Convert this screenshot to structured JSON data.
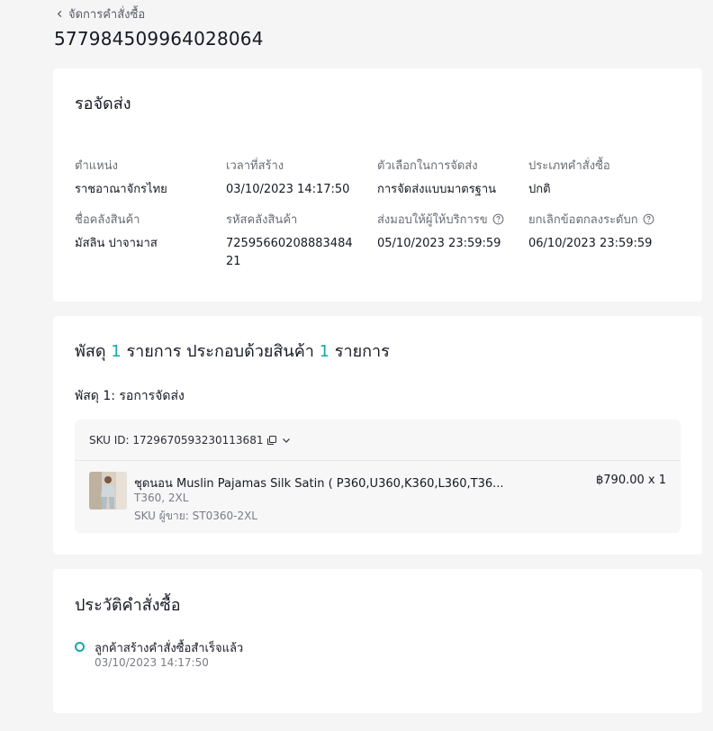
{
  "header": {
    "back_label": "จัดการคำสั่งซื้อ",
    "order_id": "577984509964028064"
  },
  "status_card": {
    "title": "รอจัดส่ง",
    "fields": [
      {
        "label": "ตำแหน่ง",
        "value": "ราชอาณาจักรไทย"
      },
      {
        "label": "เวลาที่สร้าง",
        "value": "03/10/2023 14:17:50"
      },
      {
        "label": "ตัวเลือกในการจัดส่ง",
        "value": "การจัดส่งแบบมาตรฐาน"
      },
      {
        "label": "ประเภทคำสั่งซื้อ",
        "value": "ปกติ"
      },
      {
        "label": "ชื่อคลังสินค้า",
        "value": "มัสลิน ปาจามาส"
      },
      {
        "label": "รหัสคลังสินค้า",
        "value": "7259566020888348421"
      },
      {
        "label": "ส่งมอบให้ผู้ให้บริการข",
        "value": "05/10/2023 23:59:59"
      },
      {
        "label": "ยกเลิกข้อตกลงระดับก",
        "value": "06/10/2023 23:59:59"
      }
    ]
  },
  "package_card": {
    "heading_prefix": "พัสดุ",
    "package_count": "1",
    "heading_middle": "รายการ ประกอบด้วยสินค้า",
    "item_count": "1",
    "heading_suffix": "รายการ",
    "subheading": "พัสดุ 1: รอการจัดส่ง",
    "sku_id_label": "SKU ID: 1729670593230113681",
    "product": {
      "name": "ชุดนอน Muslin Pajamas Silk Satin ( P360,U360,K360,L360,T36...",
      "variant": "T360, 2XL",
      "seller_sku": "SKU ผู้ขาย: ST0360-2XL",
      "price_qty": "฿790.00 x 1"
    }
  },
  "history_card": {
    "title": "ประวัติคำสั่งซื้อ",
    "events": [
      {
        "text": "ลูกค้าสร้างคำสั่งซื้อสำเร็จแล้ว",
        "time": "03/10/2023 14:17:50"
      }
    ]
  },
  "colors": {
    "accent": "#1aa6a6",
    "background": "#f5f5f5",
    "card": "#ffffff"
  }
}
